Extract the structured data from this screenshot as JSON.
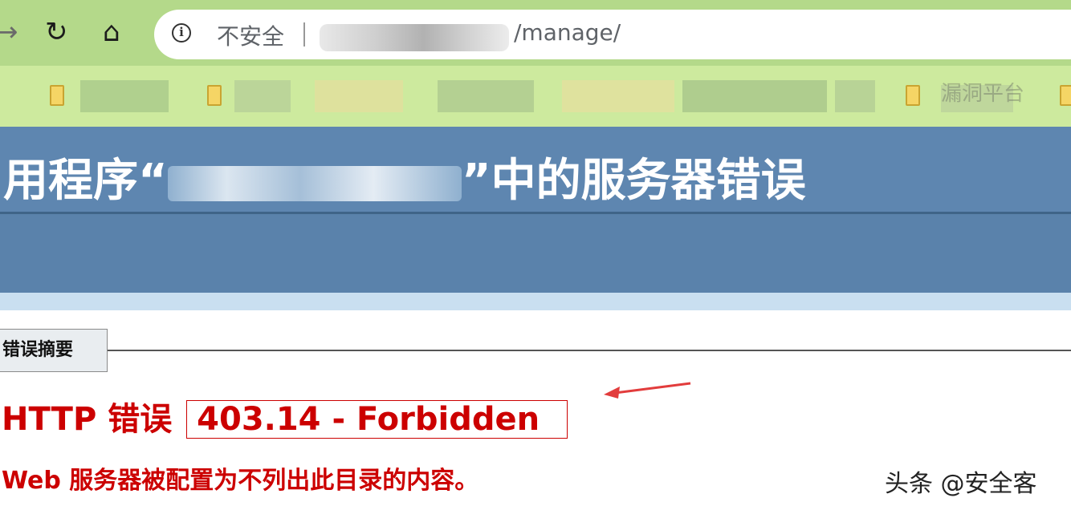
{
  "browser": {
    "security_label": "不安全",
    "url_path": "/manage/",
    "bookmark_visible_text": "漏洞平台"
  },
  "error_page": {
    "title_prefix": "用程序“",
    "title_suffix": "”中的服务器错误",
    "summary_tab": "错误摘要",
    "http_error_label": "HTTP 错误",
    "error_code": "403.14 - Forbidden",
    "error_description": "Web 服务器被配置为不列出此目录的内容。"
  },
  "watermark": "头条 @安全客",
  "colors": {
    "header_blue": "#5e86b0",
    "error_red": "#cc0000",
    "chrome_green": "#b4d98a"
  }
}
